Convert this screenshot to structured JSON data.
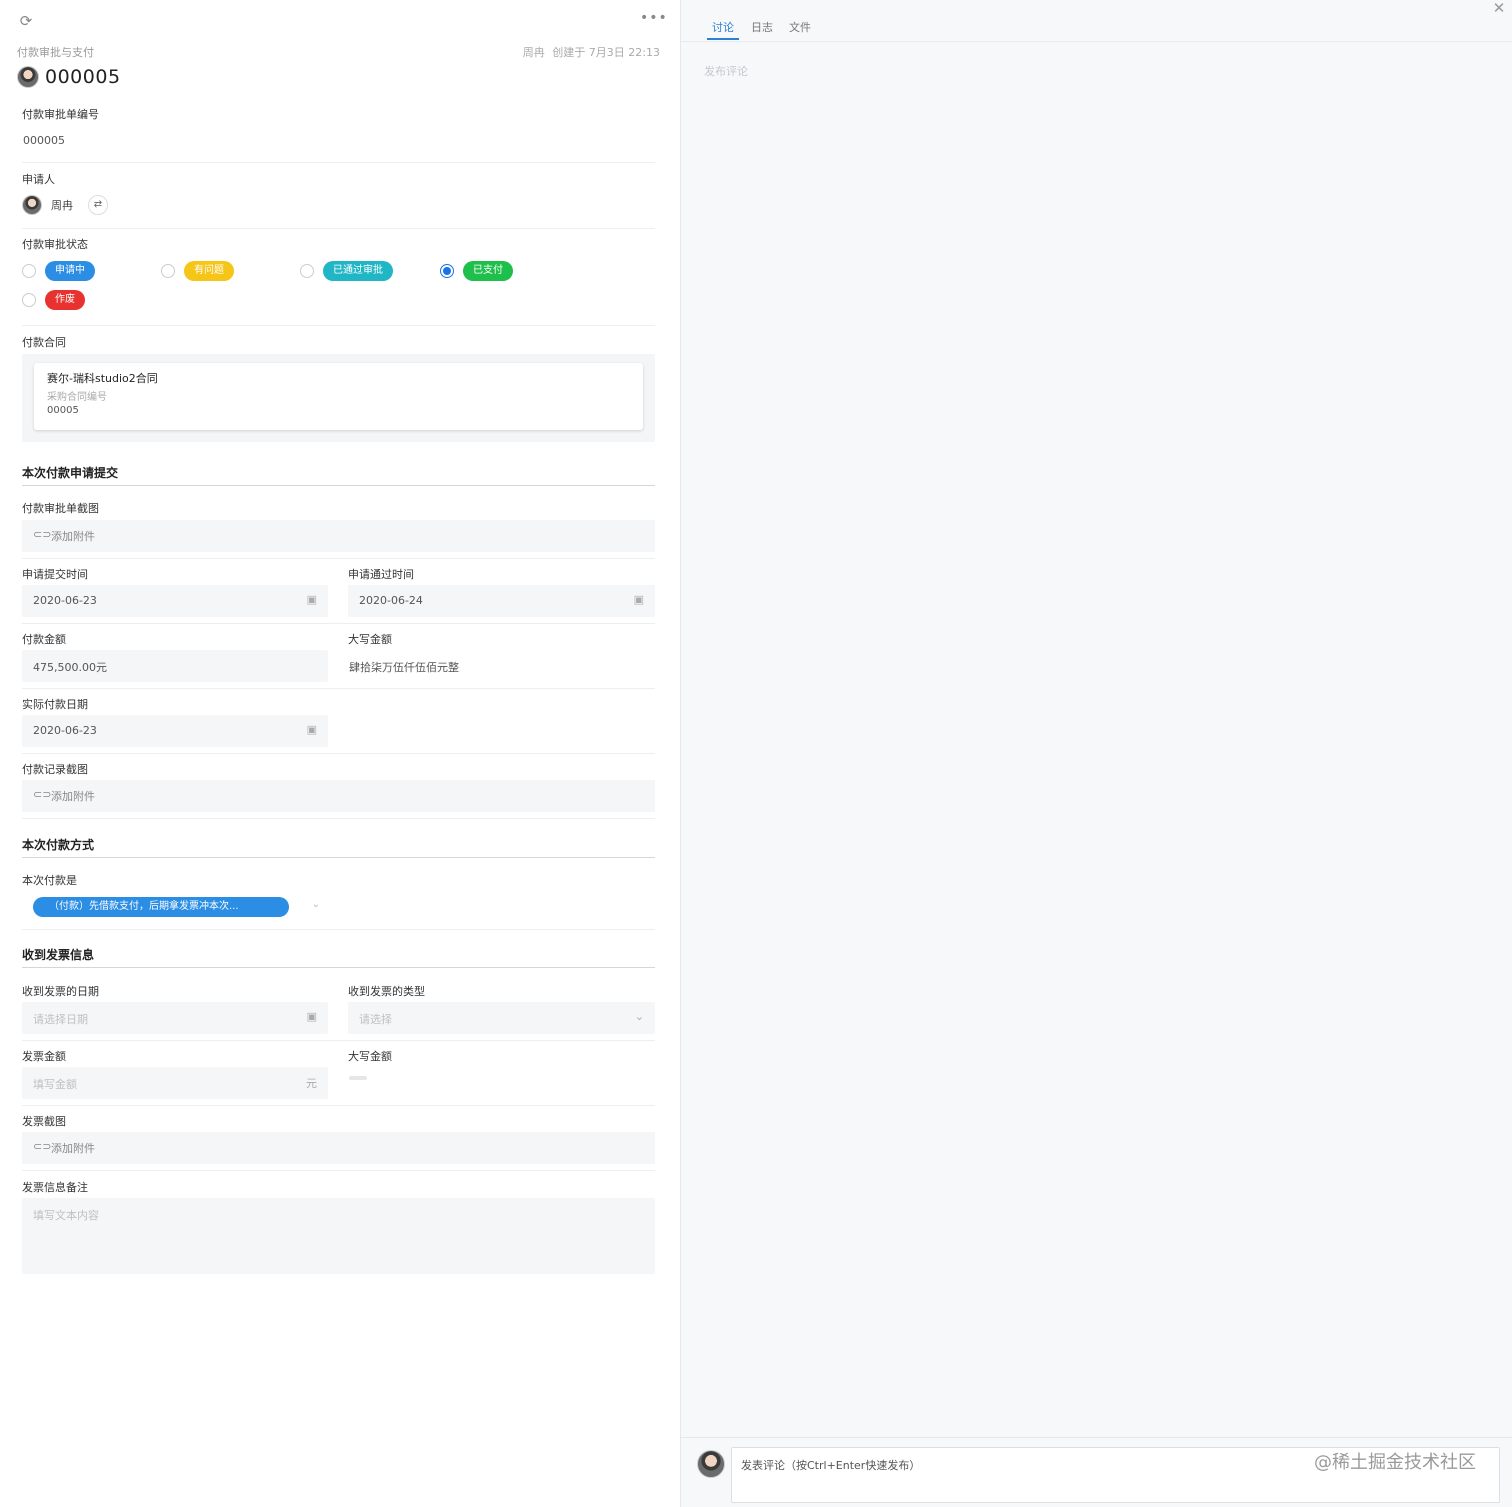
{
  "header": {
    "refresh_icon": "refresh-icon",
    "more_icon": "more-icon",
    "breadcrumb": "付款审批与支付",
    "creator": "周冉",
    "created_text": "创建于 7月3日 22:13",
    "title": "000005"
  },
  "fields": {
    "order_no_label": "付款审批单编号",
    "order_no_value": "000005",
    "applicant_label": "申请人",
    "applicant_name": "周冉",
    "status_label": "付款审批状态",
    "status_options": [
      {
        "label": "申请中",
        "color": "#2b8de3",
        "checked": false
      },
      {
        "label": "有问题",
        "color": "#f5c518",
        "checked": false
      },
      {
        "label": "已通过审批",
        "color": "#21b6c6",
        "checked": false
      },
      {
        "label": "已支付",
        "color": "#1fbf4b",
        "checked": true
      },
      {
        "label": "作废",
        "color": "#e8322f",
        "checked": false
      }
    ],
    "contract_label": "付款合同",
    "contract_name": "赛尔-瑞科studio2合同",
    "contract_sub": "采购合同编号",
    "contract_no": "00005"
  },
  "submit_section": {
    "title": "本次付款申请提交",
    "screenshot_label": "付款审批单截图",
    "attach_label": "添加附件",
    "submit_time_label": "申请提交时间",
    "submit_time_value": "2020-06-23",
    "pass_time_label": "申请通过时间",
    "pass_time_value": "2020-06-24",
    "amount_label": "付款金额",
    "amount_value": "475,500.00元",
    "upper_amount_label": "大写金额",
    "upper_amount_value": "肆拾柒万伍仟伍佰元整",
    "actual_date_label": "实际付款日期",
    "actual_date_value": "2020-06-23",
    "record_label": "付款记录截图",
    "record_attach": "添加附件"
  },
  "method_section": {
    "title": "本次付款方式",
    "label": "本次付款是",
    "value": "（付款）先借款支付，后期拿发票冲本次..."
  },
  "invoice_section": {
    "title": "收到发票信息",
    "date_label": "收到发票的日期",
    "date_placeholder": "请选择日期",
    "type_label": "收到发票的类型",
    "type_placeholder": "请选择",
    "amount_label": "发票金额",
    "amount_placeholder": "填写金额",
    "amount_unit": "元",
    "upper_label": "大写金额",
    "screenshot_label": "发票截图",
    "attach_label": "添加附件",
    "note_label": "发票信息备注",
    "note_placeholder": "填写文本内容"
  },
  "right_panel": {
    "tabs": [
      "讨论",
      "日志",
      "文件"
    ],
    "active_tab": "讨论",
    "post_link": "发布评论",
    "comment_placeholder": "发表评论（按Ctrl+Enter快速发布）",
    "watermark": "@稀土掘金技术社区",
    "accent_color": "#2b7fd4"
  }
}
